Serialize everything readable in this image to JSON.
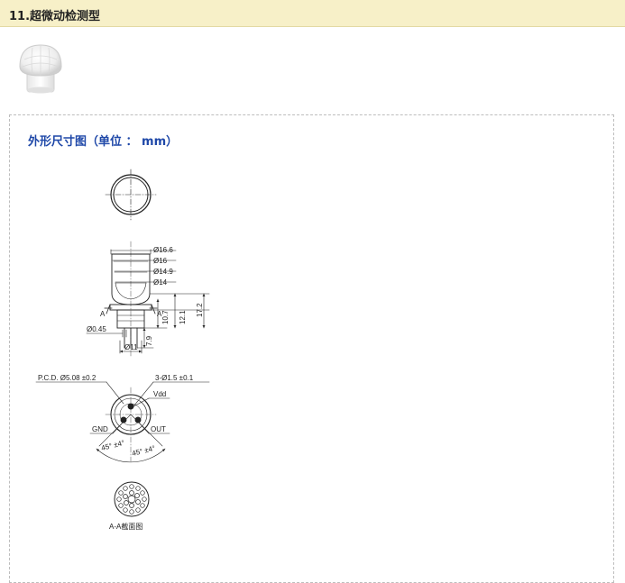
{
  "header": {
    "title": "11.超微动检测型"
  },
  "product": {
    "icon": "sensor-lens-photo"
  },
  "section": {
    "title": "外形尺寸图（单位 ： mm）"
  },
  "side_view": {
    "dims": {
      "d1": "Ø16.6",
      "d2": "Ø16",
      "d3": "Ø14.9",
      "d4": "Ø14",
      "h1": "10.7",
      "h2": "12.1",
      "h3": "17.2",
      "pin": "Ø0.45",
      "base": "Ø11",
      "lead": "7.9"
    },
    "section_mark_left": "A",
    "section_mark_right": "A"
  },
  "bottom_view": {
    "pcd": "P.C.D. Ø5.08 ±0.2",
    "holes": "3-Ø1.5 ±0.1",
    "vdd": "Vdd",
    "gnd": "GND",
    "out": "OUT",
    "angle_left": "45° ±4°",
    "angle_right": "45° ±4°"
  },
  "section_view": {
    "caption": "A-A截面图"
  }
}
